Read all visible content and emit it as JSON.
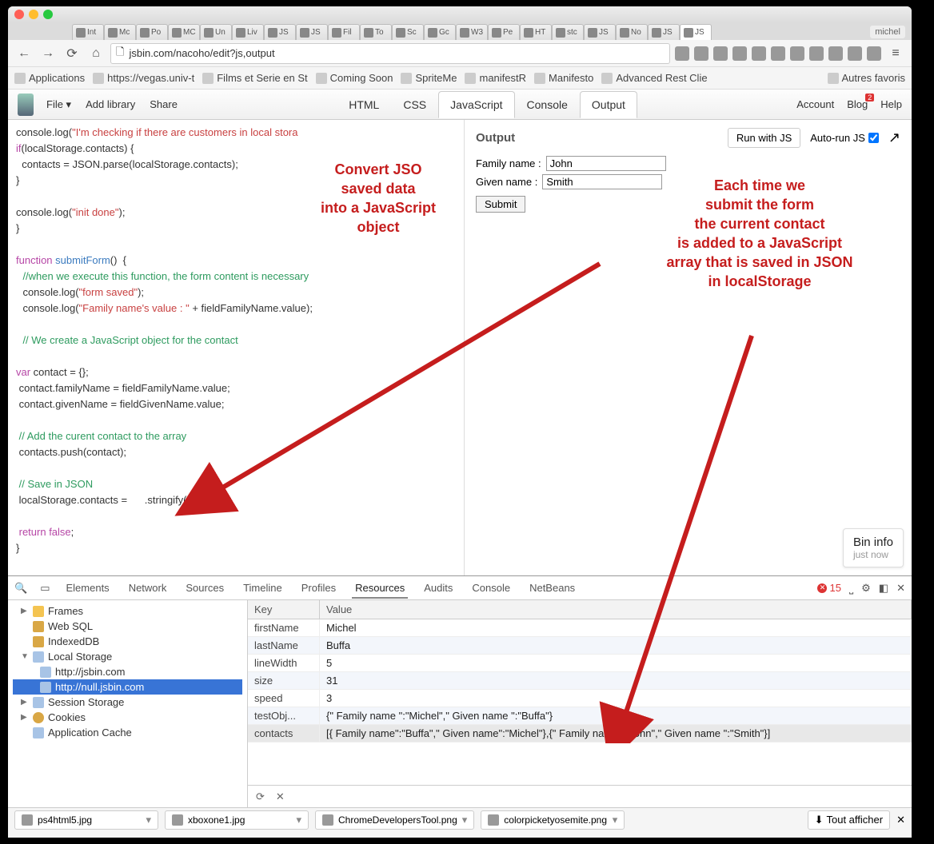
{
  "browser": {
    "user": "michel",
    "url": "jsbin.com/nacoho/edit?js,output",
    "tabs": [
      "Int",
      "Mc",
      "Po",
      "MC",
      "Un",
      "Liv",
      "JS",
      "JS",
      "Fil",
      "To",
      "Sc",
      "Gc",
      "W3",
      "Pe",
      "HT",
      "stc",
      "JS",
      "No",
      "JS",
      "JS"
    ],
    "nav": {
      "back": "←",
      "fwd": "→",
      "reload": "⟳",
      "home": "⌂"
    },
    "bookmarks": [
      "Applications",
      "https://vegas.univ-t",
      "Films et Serie en St",
      "Coming Soon",
      "SpriteMe",
      "manifestR",
      "Manifesto",
      "Advanced Rest Clie"
    ],
    "bookmarks_right": "Autres favoris"
  },
  "jsbin": {
    "menu": [
      "File ▾",
      "Add library",
      "Share"
    ],
    "panels": [
      "HTML",
      "CSS",
      "JavaScript",
      "Console",
      "Output"
    ],
    "right": [
      "Account",
      "Blog",
      "Help"
    ],
    "blog_badge": "2",
    "output": {
      "title": "Output",
      "run": "Run with JS",
      "autorun": "Auto-run JS",
      "family_label": "Family name :",
      "given_label": "Given name  :",
      "family_value": "John",
      "given_value": "Smith",
      "submit": "Submit"
    },
    "bin_info": {
      "title": "Bin info",
      "sub": "just now"
    },
    "code": {
      "l1a": "console",
      "l1b": ".log(",
      "l1c": "\"I'm checking if there are customers in local stora",
      "l1d": "",
      "l2a": "if",
      "l2b": "(localStorage.contacts) {",
      "l3": "  contacts = JSON.parse(localStorage.contacts);",
      "l4": "}",
      "l5a": "console",
      "l5b": ".log(",
      "l5c": "\"init done\"",
      "l5d": ");",
      "l6": "}",
      "l7a": "function ",
      "l7b": "submitForm",
      "l7c": "()  {",
      "l8": "//when we execute this function, the form content is necessary",
      "l9a": "console",
      "l9b": ".log(",
      "l9c": "\"form saved\"",
      "l9d": ");",
      "l10a": "console",
      "l10b": ".log(",
      "l10c": "\"Family name's value : \"",
      "l10d": " + fieldFamilyName.value);",
      "l11": "// We create a JavaScript object for the contact",
      "l12a": "var",
      "l12b": " contact = {};",
      "l13": " contact.familyName = fieldFamilyName.value;",
      "l14": " contact.givenName = fieldGivenName.value;",
      "l15": " // Add the curent contact to the array",
      "l16": " contacts.push(contact);",
      "l17": " // Save in JSON",
      "l18": " localStorage.contacts =      .stringify(contacts);",
      "l19a": " return ",
      "l19b": "false",
      "l19c": ";",
      "l20": "}"
    }
  },
  "annotations": {
    "left": "Convert JSO\nsaved data\ninto a JavaScript\nobject",
    "right": "Each time we\nsubmit the form\nthe current contact\nis added to a JavaScript\narray that is saved in JSON\nin localStorage"
  },
  "devtools": {
    "tabs": [
      "Elements",
      "Network",
      "Sources",
      "Timeline",
      "Profiles",
      "Resources",
      "Audits",
      "Console",
      "NetBeans"
    ],
    "errors": "15",
    "tree": {
      "frames": "Frames",
      "websql": "Web SQL",
      "idb": "IndexedDB",
      "ls": "Local Storage",
      "ls1": "http://jsbin.com",
      "ls2": "http://null.jsbin.com",
      "ss": "Session Storage",
      "cookies": "Cookies",
      "appcache": "Application Cache"
    },
    "table": {
      "key_header": "Key",
      "val_header": "Value",
      "rows": [
        {
          "k": "firstName",
          "v": "Michel"
        },
        {
          "k": "lastName",
          "v": "Buffa"
        },
        {
          "k": "lineWidth",
          "v": "5"
        },
        {
          "k": "size",
          "v": "31"
        },
        {
          "k": "speed",
          "v": "3"
        },
        {
          "k": "testObj...",
          "v": "{\" Family name \":\"Michel\",\" Given name \":\"Buffa\"}"
        },
        {
          "k": "contacts",
          "v": "[{ Family name\":\"Buffa\",\" Given name\":\"Michel\"},{\" Family name\":\"John\",\" Given name \":\"Smith\"}]"
        }
      ]
    }
  },
  "downloads": {
    "files": [
      "ps4html5.jpg",
      "xboxone1.jpg",
      "ChromeDevelopersTool.png",
      "colorpicketyosemite.png"
    ],
    "show_all": "Tout afficher"
  }
}
